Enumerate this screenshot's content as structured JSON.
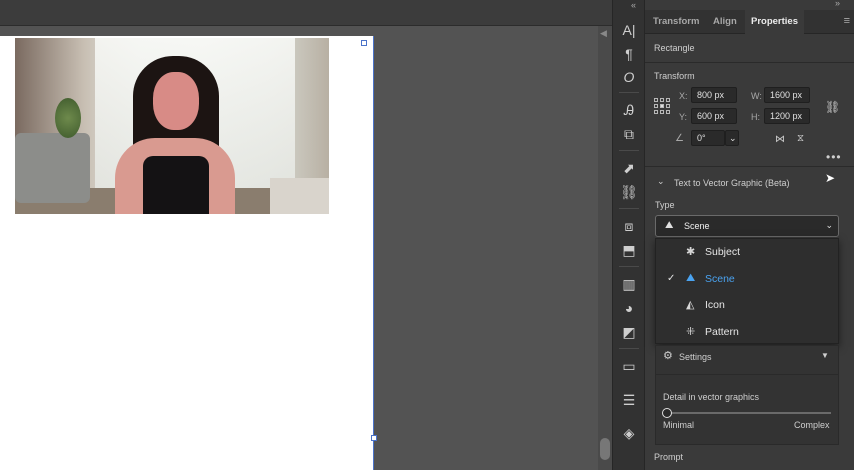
{
  "panel": {
    "tabs": [
      "Transform",
      "Align",
      "Properties"
    ],
    "active_tab": "Properties",
    "object_type": "Rectangle",
    "transform": {
      "heading": "Transform",
      "x_label": "X:",
      "x_value": "800 px",
      "y_label": "Y:",
      "y_value": "600 px",
      "w_label": "W:",
      "w_value": "1600 px",
      "h_label": "H:",
      "h_value": "1200 px",
      "angle_value": "0°"
    },
    "text_to_vector": {
      "heading": "Text to Vector Graphic (Beta)",
      "type_label": "Type",
      "selected_type": "Scene",
      "options": [
        {
          "label": "Subject",
          "icon": "subject-icon",
          "checked": false
        },
        {
          "label": "Scene",
          "icon": "scene-icon",
          "checked": true
        },
        {
          "label": "Icon",
          "icon": "icon-type-icon",
          "checked": false
        },
        {
          "label": "Pattern",
          "icon": "pattern-icon",
          "checked": false
        }
      ],
      "settings_label": "Settings",
      "detail_label": "Detail in vector graphics",
      "detail_min": "Minimal",
      "detail_max": "Complex",
      "detail_level": 0.0,
      "prompt_label": "Prompt"
    }
  },
  "colors": {
    "accent": "#4aa3f0",
    "panel_bg": "#3a3a3a",
    "canvas_bg": "#535353",
    "selection": "#4b73c9"
  }
}
